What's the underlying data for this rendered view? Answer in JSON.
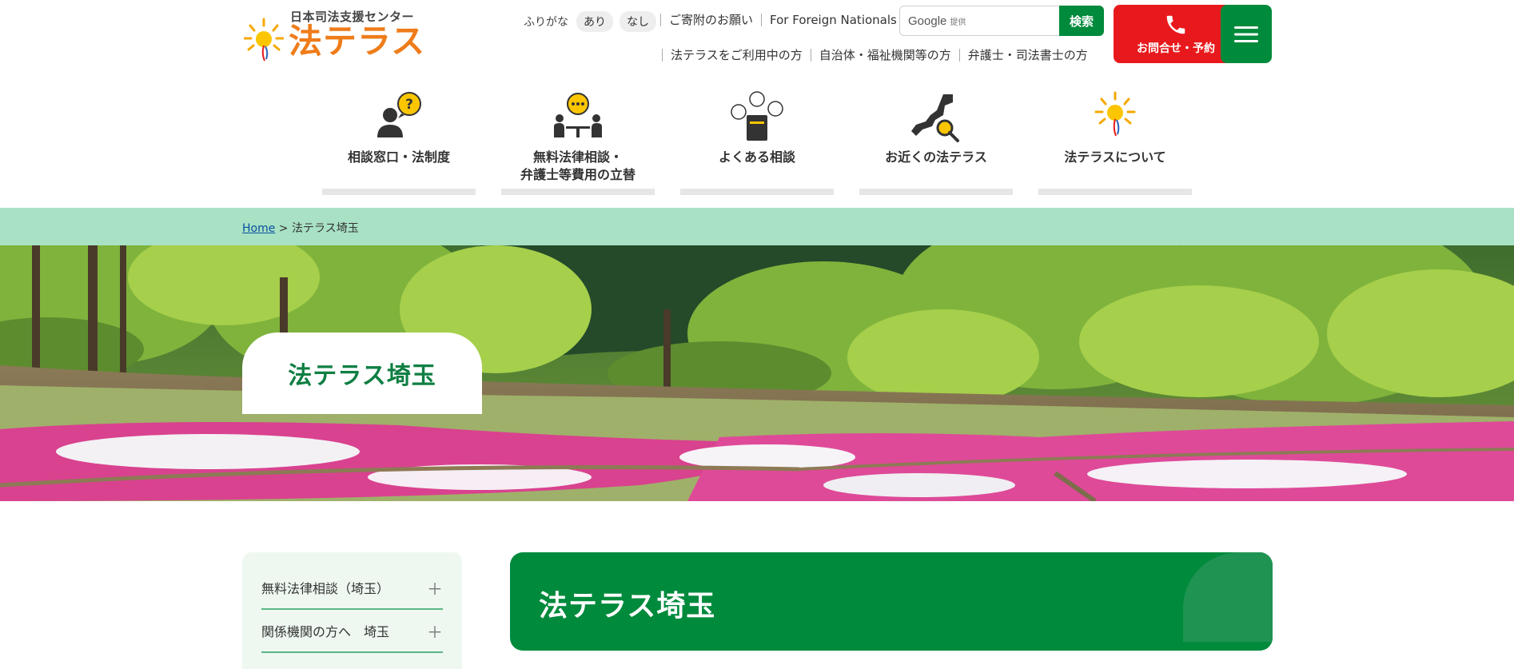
{
  "logo": {
    "subtitle": "日本司法支援センター",
    "title": "法テラス"
  },
  "furigana": {
    "label": "ふりがな",
    "on": "あり",
    "off": "なし"
  },
  "top_links": [
    "ご寄附のお願い",
    "For Foreign Nationals"
  ],
  "search": {
    "brand": "Google",
    "provided": "提供",
    "button": "検索"
  },
  "contact_button": "お問合せ・予約",
  "sub_links": [
    "法テラスをご利用中の方",
    "自治体・福祉機関等の方",
    "弁護士・司法書士の方"
  ],
  "main_nav": [
    {
      "label": "相談窓口・法制度",
      "icon": "person-question-icon"
    },
    {
      "label_line1": "無料法律相談・",
      "label_line2": "弁護士等費用の立替",
      "icon": "consultation-icon"
    },
    {
      "label": "よくある相談",
      "icon": "faq-book-icon"
    },
    {
      "label": "お近くの法テラス",
      "icon": "japan-map-search-icon"
    },
    {
      "label": "法テラスについて",
      "icon": "sun-logo-icon"
    }
  ],
  "breadcrumb": {
    "home": "Home",
    "separator": ">",
    "current": "法テラス埼玉"
  },
  "hero": {
    "title": "法テラス埼玉"
  },
  "sidebar": {
    "items": [
      "無料法律相談（埼玉）",
      "関係機関の方へ　埼玉"
    ]
  },
  "page_heading": "法テラス埼玉",
  "colors": {
    "brand_green": "#008a3c",
    "accent_orange": "#ef7c1a",
    "contact_red": "#e8191c",
    "breadcrumb_bg": "#a8e1c4"
  }
}
